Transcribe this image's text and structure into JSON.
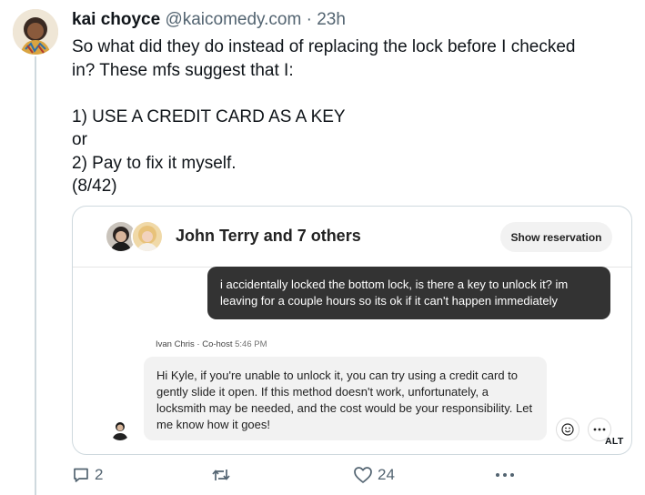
{
  "tweet": {
    "author_name": "kai choyce",
    "author_handle": "@kaicomedy.com",
    "separator": "·",
    "time": "23h",
    "text_lines": [
      "So what did they do instead of replacing the lock before I checked",
      "in? These mfs suggest that I:",
      "",
      "1) USE A CREDIT CARD AS A KEY",
      "or",
      "2) Pay to fix it myself.",
      "(8/42)"
    ]
  },
  "embedded_chat": {
    "participants": "John Terry and 7 others",
    "show_reservation_label": "Show reservation",
    "outgoing_message": "i accidentally locked the bottom lock, is there a key to unlock it? im leaving for a couple hours so its ok if it can't happen immediately",
    "reply_sender": "Ivan Chris · Co-host",
    "reply_time": "5:46 PM",
    "reply_message": "Hi Kyle, if you're unable to unlock it, you can try using a credit card to gently slide it open. If this method doesn't work, unfortunately, a locksmith may be needed, and the cost would be your responsibility. Let me know how it goes!",
    "alt_badge": "ALT"
  },
  "actions": {
    "reply_count": "2",
    "like_count": "24"
  },
  "icons": [
    "reply-icon",
    "repost-icon",
    "like-icon",
    "more-icon",
    "emoji-icon",
    "ellipsis-icon"
  ],
  "colors": {
    "text_primary": "#0f1419",
    "text_secondary": "#536471",
    "border": "#cfd9de",
    "outgoing_bubble": "#333333",
    "incoming_bubble": "#f2f2f2"
  }
}
